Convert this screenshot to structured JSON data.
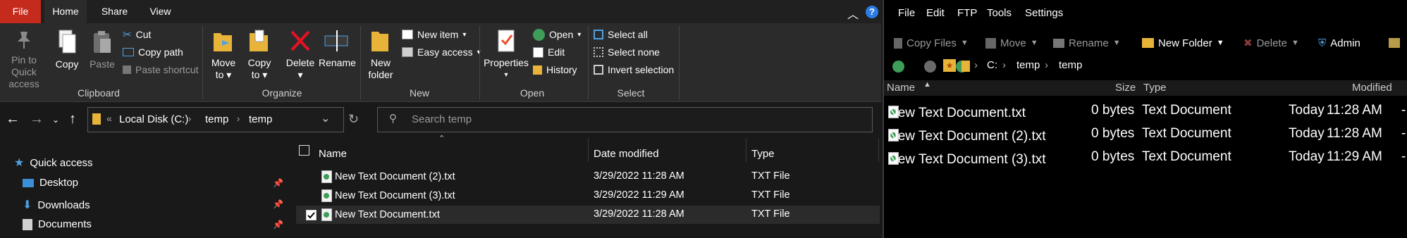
{
  "explorer": {
    "tabs": {
      "file": "File",
      "home": "Home",
      "share": "Share",
      "view": "View"
    },
    "ribbon": {
      "clipboard": {
        "pin": "Pin to Quick access",
        "copy": "Copy",
        "paste": "Paste",
        "cut": "Cut",
        "copy_path": "Copy path",
        "paste_shortcut": "Paste shortcut",
        "label": "Clipboard"
      },
      "organize": {
        "move_to": "Move to",
        "copy_to": "Copy to",
        "delete": "Delete",
        "rename": "Rename",
        "label": "Organize"
      },
      "new": {
        "new_folder": "New folder",
        "new_item": "New item",
        "easy_access": "Easy access",
        "label": "New"
      },
      "open": {
        "properties": "Properties",
        "open": "Open",
        "edit": "Edit",
        "history": "History",
        "label": "Open"
      },
      "select": {
        "select_all": "Select all",
        "select_none": "Select none",
        "invert": "Invert selection",
        "label": "Select"
      }
    },
    "address": {
      "root": "Local Disk (C:)",
      "parts": [
        "temp",
        "temp"
      ]
    },
    "search": {
      "placeholder": "Search temp"
    },
    "nav": {
      "quick_access": "Quick access",
      "items": [
        "Desktop",
        "Downloads",
        "Documents"
      ]
    },
    "columns": {
      "name": "Name",
      "date": "Date modified",
      "type": "Type"
    },
    "files": [
      {
        "name": "New Text Document (2).txt",
        "date": "3/29/2022 11:28 AM",
        "type": "TXT File"
      },
      {
        "name": "New Text Document (3).txt",
        "date": "3/29/2022 11:29 AM",
        "type": "TXT File"
      },
      {
        "name": "New Text Document.txt",
        "date": "3/29/2022 11:28 AM",
        "type": "TXT File"
      }
    ]
  },
  "manager": {
    "menu": [
      "File",
      "Edit",
      "FTP",
      "Tools",
      "Settings"
    ],
    "toolbar": {
      "copy_files": "Copy Files",
      "move": "Move",
      "rename": "Rename",
      "new_folder": "New Folder",
      "delete": "Delete",
      "admin": "Admin"
    },
    "path": {
      "drive": "C:",
      "parts": [
        "temp",
        "temp"
      ]
    },
    "columns": {
      "name": "Name",
      "size": "Size",
      "type": "Type",
      "modified": "Modified"
    },
    "files": [
      {
        "name": "New Text Document.txt",
        "size": "0 bytes",
        "type": "Text Document",
        "day": "Today",
        "time": "11:28 AM"
      },
      {
        "name": "New Text Document (2).txt",
        "size": "0 bytes",
        "type": "Text Document",
        "day": "Today",
        "time": "11:28 AM"
      },
      {
        "name": "New Text Document (3).txt",
        "size": "0 bytes",
        "type": "Text Document",
        "day": "Today",
        "time": "11:29 AM"
      }
    ]
  },
  "colors": {
    "file_tab": "#c42b1c",
    "ribbon": "#2b2b2b",
    "background": "#191919",
    "manager_bg": "#000000",
    "folder": "#e8b339",
    "accent": "#4ea2e6"
  }
}
